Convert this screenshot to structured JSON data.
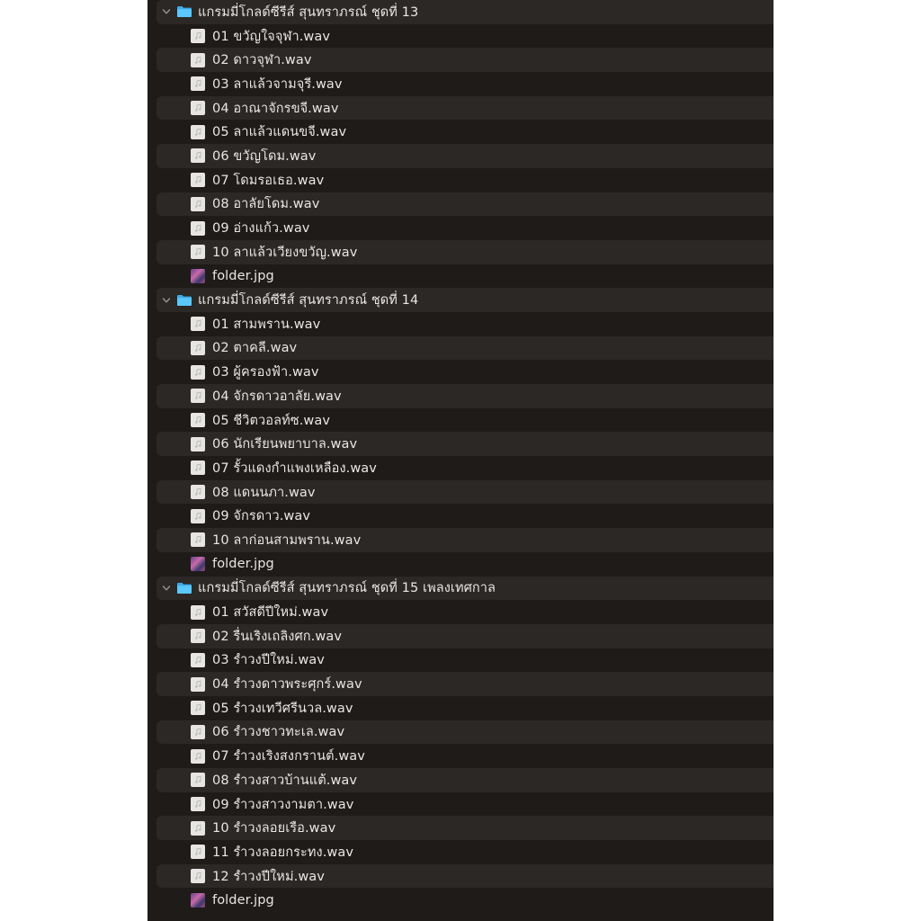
{
  "folders": [
    {
      "name": "แกรมมี่โกลด์ซีรีส์ สุนทราภรณ์ ชุดที่ 13",
      "files": [
        "01  ขวัญใจจุฬา.wav",
        "02  ดาวจุฬา.wav",
        "03  ลาแล้วจามจุรี.wav",
        "04  อาณาจักรขจี.wav",
        "05 ลาแล้วแดนขจี.wav",
        "06  ขวัญโดม.wav",
        "07 โดมรอเธอ.wav",
        "08  อาลัยโดม.wav",
        "09 อ่างแก้ว.wav",
        "10  ลาแล้วเวียงขวัญ.wav"
      ],
      "image": "folder.jpg"
    },
    {
      "name": "แกรมมี่โกลด์ซีรีส์ สุนทราภรณ์ ชุดที่ 14",
      "files": [
        "01  สามพราน.wav",
        "02  ตาคลี.wav",
        "03  ผู้ครองฟ้า.wav",
        "04  จักรดาวอาลัย.wav",
        "05  ชีวิตวอลท์ซ.wav",
        "06 นักเรียนพยาบาล.wav",
        "07  รั้วแดงกำแพงเหลือง.wav",
        "08 แดนนภา.wav",
        "09 จักรดาว.wav",
        "10 ลาก่อนสามพราน.wav"
      ],
      "image": "folder.jpg"
    },
    {
      "name": "แกรมมี่โกลด์ซีรีส์ สุนทราภรณ์ ชุดที่ 15 เพลงเทศกาล",
      "files": [
        "01  สวัสดีปีใหม่.wav",
        "02  รื่นเริงเถลิงศก.wav",
        "03 รำวงปีใหม่.wav",
        "04 รำวงดาวพระศุกร์.wav",
        "05 รำวงเทวีศรีนวล.wav",
        "06  รำวงชาวทะเล.wav",
        "07  รำวงเริงสงกรานต์.wav",
        "08 รำวงสาวบ้านแต้.wav",
        "09 รำวงสาวงามตา.wav",
        "10  รำวงลอยเรือ.wav",
        "11 รำวงลอยกระทง.wav",
        "12 รำวงปีใหม่.wav"
      ],
      "image": "folder.jpg"
    }
  ],
  "colors": {
    "background": "#1e1b19",
    "row_alt": "#2b2825",
    "text": "#e9e6e3",
    "folder_icon": "#5ac8fa"
  },
  "icons": {
    "disclosure": "chevron-down-icon",
    "folder": "folder-icon",
    "audio_file": "audio-file-icon",
    "image_file": "image-file-icon"
  }
}
